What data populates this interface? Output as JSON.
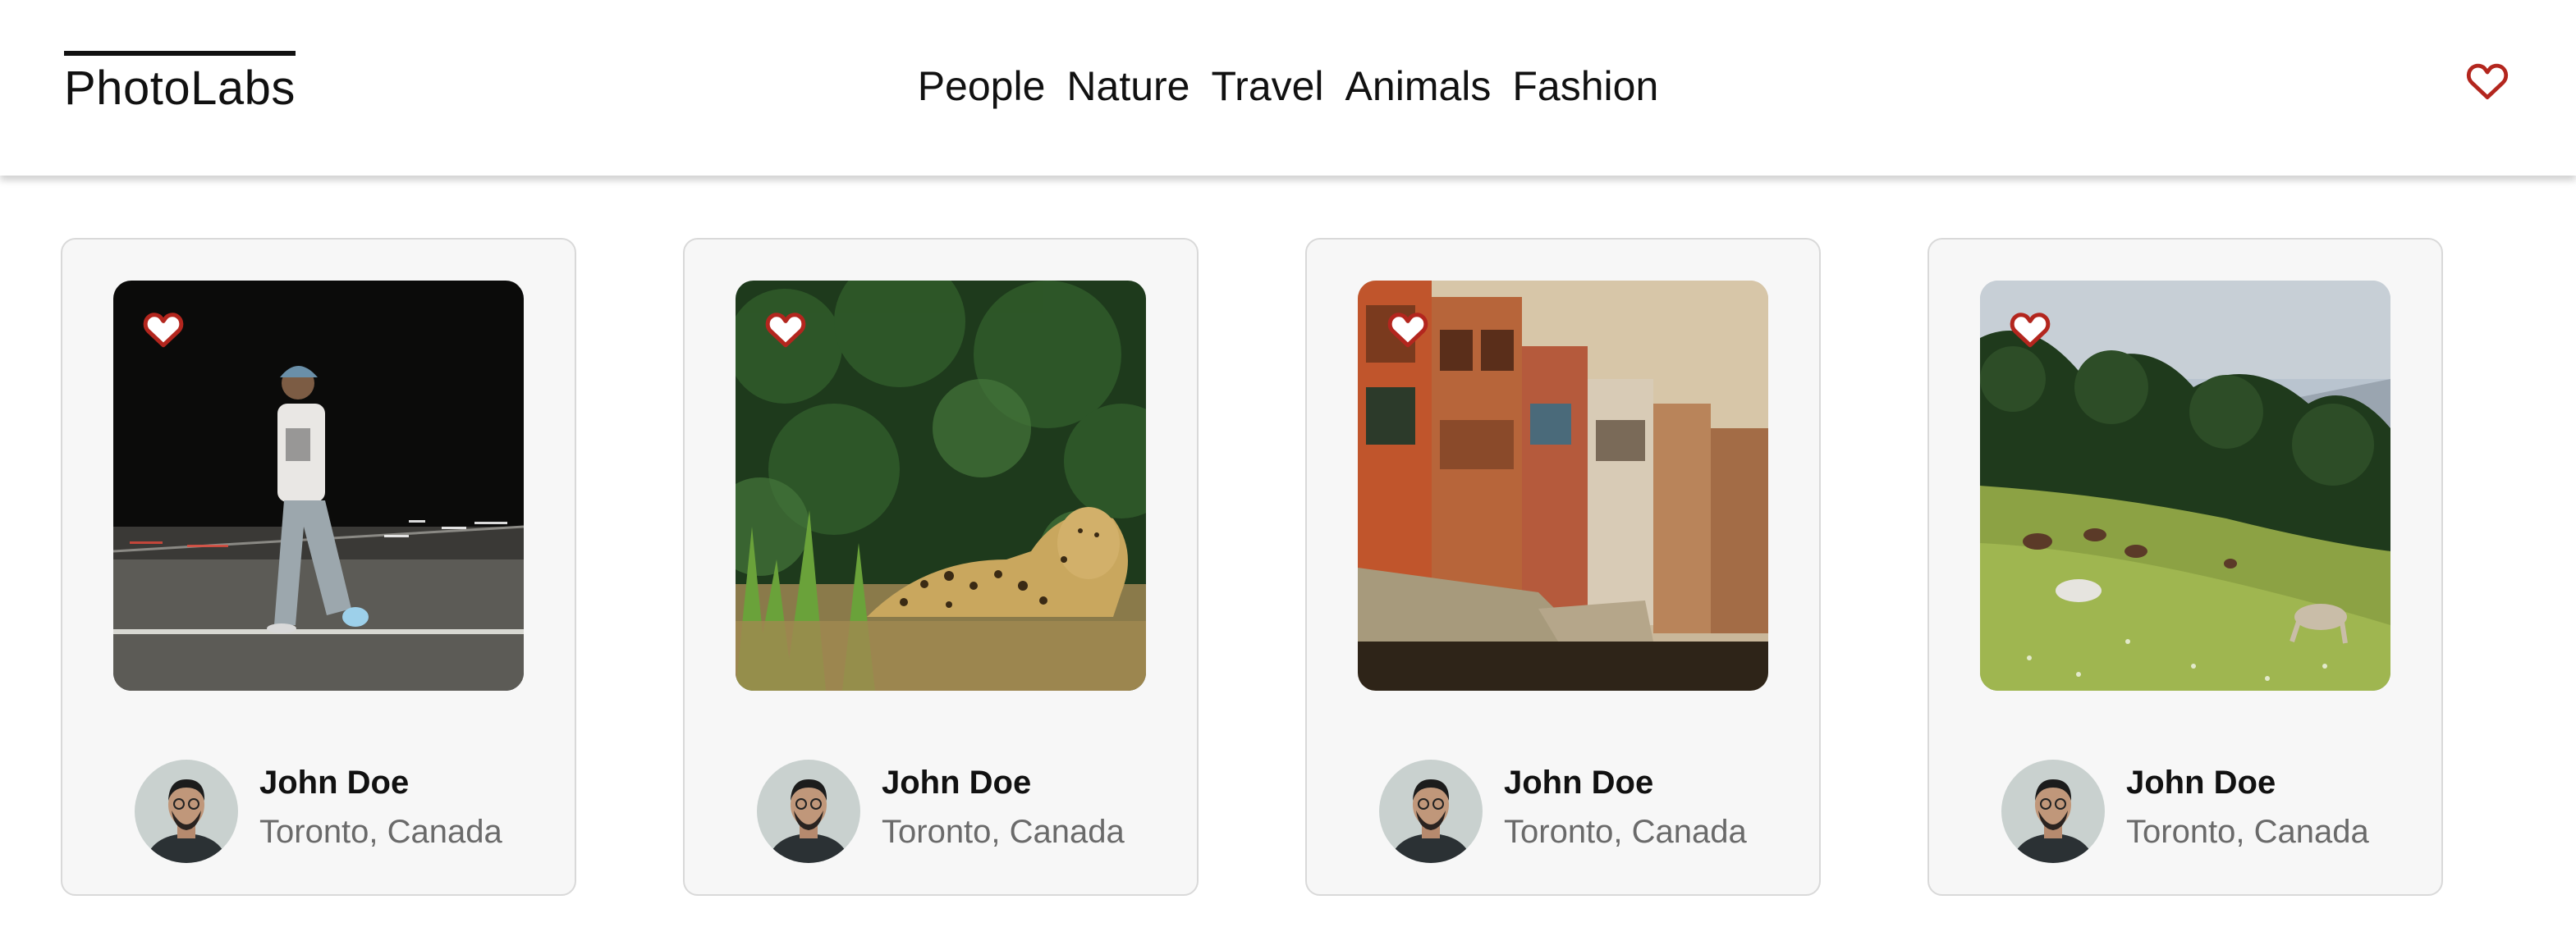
{
  "app": {
    "logo": "PhotoLabs",
    "topics": [
      "People",
      "Nature",
      "Travel",
      "Animals",
      "Fashion"
    ],
    "accent_color": "#b3261e",
    "fav_icon": "heart-icon"
  },
  "photos": [
    {
      "scene": "person walking at night",
      "user": {
        "name": "John Doe",
        "location": "Toronto, Canada"
      }
    },
    {
      "scene": "jaguar lying in grass",
      "user": {
        "name": "John Doe",
        "location": "Toronto, Canada"
      }
    },
    {
      "scene": "colorful old buildings street",
      "user": {
        "name": "John Doe",
        "location": "Toronto, Canada"
      }
    },
    {
      "scene": "horses grazing on a hill",
      "user": {
        "name": "John Doe",
        "location": "Toronto, Canada"
      }
    }
  ]
}
